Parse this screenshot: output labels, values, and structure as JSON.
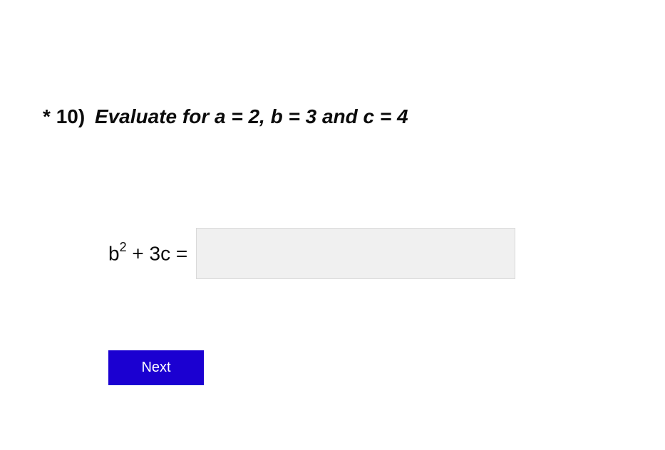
{
  "question": {
    "required_mark": "*",
    "number": "10)",
    "instruction": "Evaluate for a = 2, b = 3 and c = 4"
  },
  "expression": {
    "base": "b",
    "exponent": "2",
    "rest": " + 3c ="
  },
  "answer": {
    "value": ""
  },
  "buttons": {
    "next": "Next"
  }
}
